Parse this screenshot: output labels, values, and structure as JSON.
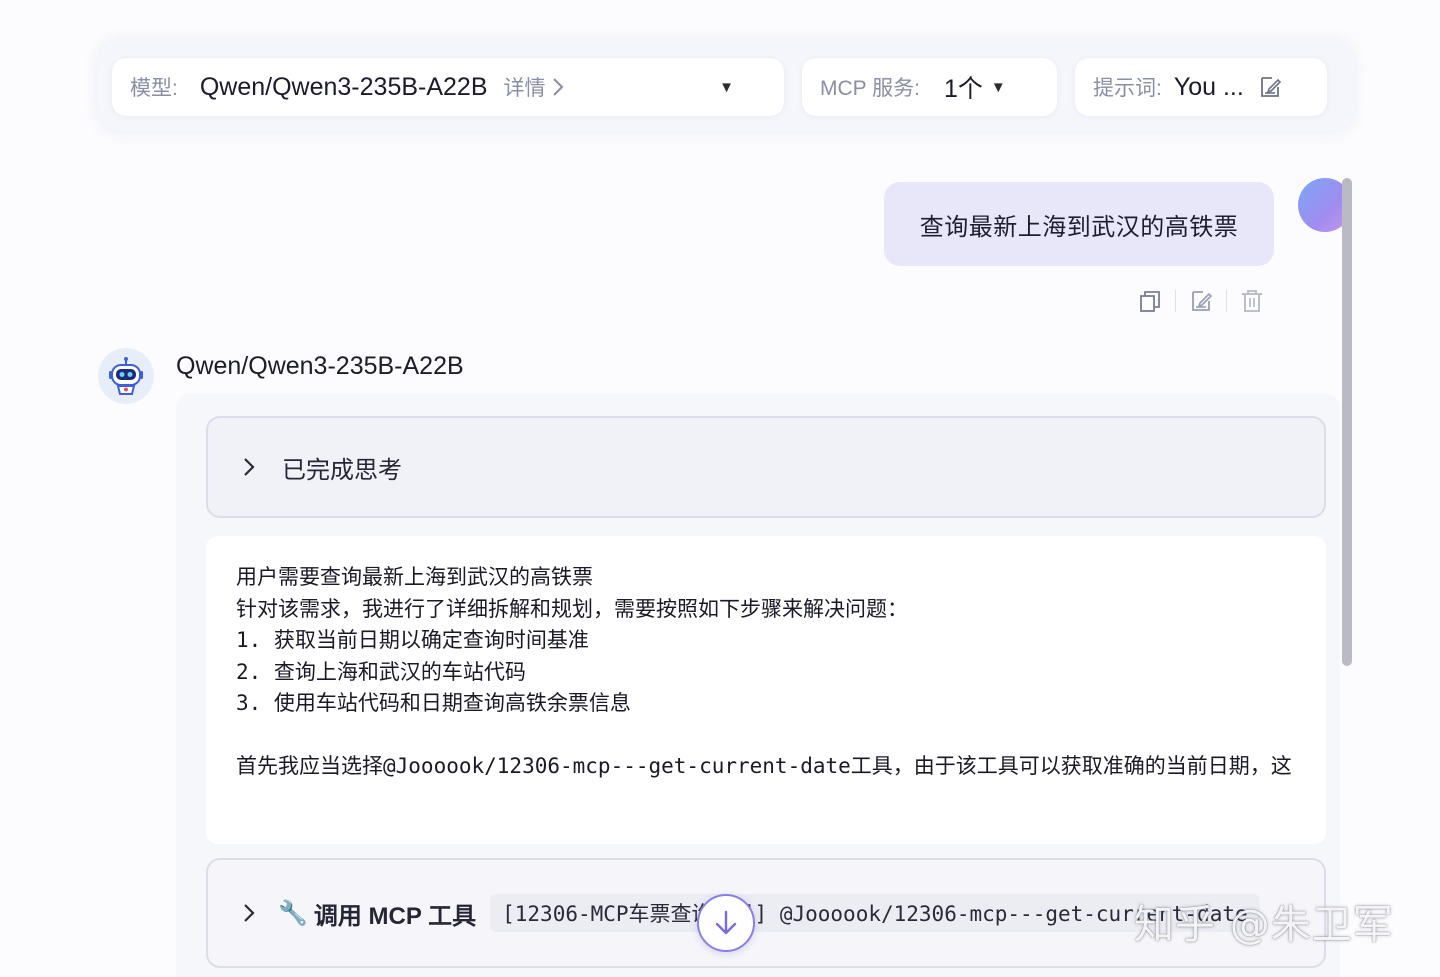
{
  "toolbar": {
    "model_label": "模型:",
    "model_value": "Qwen/Qwen3-235B-A22B",
    "model_detail": "详情",
    "mcp_label": "MCP 服务:",
    "mcp_value": "1个",
    "prompt_label": "提示词:",
    "prompt_value": "You ..."
  },
  "user_message": {
    "text": "查询最新上海到武汉的高铁票",
    "actions": [
      "copy-icon",
      "edit-icon",
      "delete-icon"
    ]
  },
  "assistant": {
    "name": "Qwen/Qwen3-235B-A22B",
    "thinking_label": "已完成思考",
    "reply_lines": [
      "用户需要查询最新上海到武汉的高铁票",
      "针对该需求，我进行了详细拆解和规划，需要按照如下步骤来解决问题：",
      "1. 获取当前日期以确定查询时间基准",
      "2. 查询上海和武汉的车站代码",
      "3. 使用车站代码和日期查询高铁余票信息",
      "",
      "首先我应当选择@Joooook/12306-mcp---get-current-date工具，由于该工具可以获取准确的当前日期，这"
    ],
    "tool_call": {
      "title": "调用 MCP 工具",
      "detail": "[12306-MCP车票查询工具] @Joooook/12306-mcp---get-current-date"
    }
  },
  "watermark": "知乎 @朱卫军",
  "colors": {
    "accent": "#8b7ee6",
    "user_bubble": "#e8e6f9",
    "panel": "#f6f7fb"
  }
}
